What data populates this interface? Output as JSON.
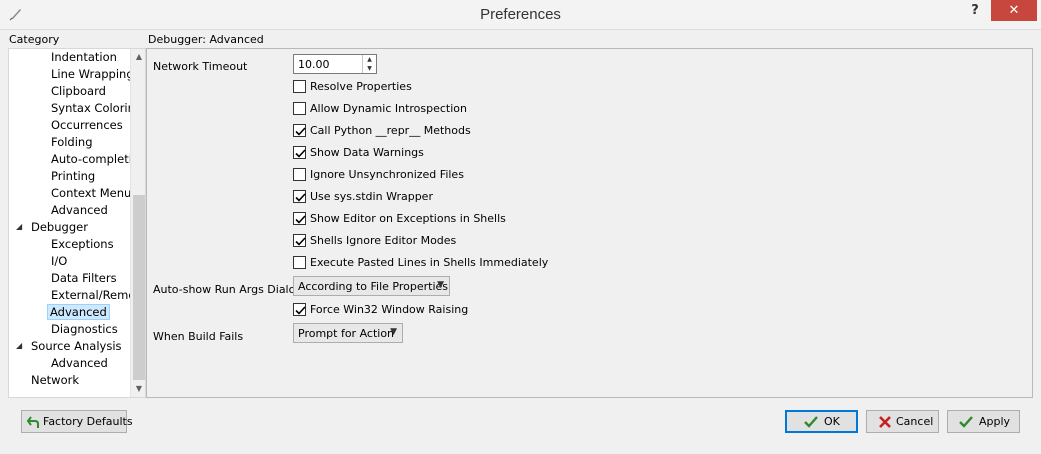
{
  "window": {
    "title": "Preferences",
    "help_label": "?",
    "close_label": "✕"
  },
  "category": {
    "label": "Category",
    "items": [
      {
        "label": "Indentation",
        "level": 2
      },
      {
        "label": "Line Wrapping",
        "level": 2
      },
      {
        "label": "Clipboard",
        "level": 2
      },
      {
        "label": "Syntax Coloring",
        "level": 2
      },
      {
        "label": "Occurrences",
        "level": 2
      },
      {
        "label": "Folding",
        "level": 2
      },
      {
        "label": "Auto-completi",
        "level": 2
      },
      {
        "label": "Printing",
        "level": 2
      },
      {
        "label": "Context Menu",
        "level": 2
      },
      {
        "label": "Advanced",
        "level": 2
      },
      {
        "label": "Debugger",
        "level": 1,
        "expanded": true
      },
      {
        "label": "Exceptions",
        "level": 2
      },
      {
        "label": "I/O",
        "level": 2
      },
      {
        "label": "Data Filters",
        "level": 2
      },
      {
        "label": "External/Remo",
        "level": 2
      },
      {
        "label": "Advanced",
        "level": 2,
        "selected": true
      },
      {
        "label": "Diagnostics",
        "level": 2
      },
      {
        "label": "Source Analysis",
        "level": 1,
        "expanded": true
      },
      {
        "label": "Advanced",
        "level": 2
      },
      {
        "label": "Network",
        "level": 1
      }
    ]
  },
  "section": {
    "title": "Debugger: Advanced"
  },
  "settings": {
    "network_timeout": {
      "label": "Network Timeout",
      "value": "10.00"
    },
    "checkboxes": [
      {
        "label": "Resolve Properties",
        "checked": false
      },
      {
        "label": "Allow Dynamic Introspection",
        "checked": false
      },
      {
        "label": "Call Python __repr__ Methods",
        "checked": true
      },
      {
        "label": "Show Data Warnings",
        "checked": true
      },
      {
        "label": "Ignore Unsynchronized Files",
        "checked": false
      },
      {
        "label": "Use sys.stdin Wrapper",
        "checked": true
      },
      {
        "label": "Show Editor on Exceptions in Shells",
        "checked": true
      },
      {
        "label": "Shells Ignore Editor Modes",
        "checked": true
      },
      {
        "label": "Execute Pasted Lines in Shells Immediately",
        "checked": false
      }
    ],
    "auto_show": {
      "label": "Auto-show Run Args Dialog",
      "value": "According to File Properties"
    },
    "force_raise": {
      "label": "Force Win32 Window Raising",
      "checked": true
    },
    "build_fails": {
      "label": "When Build Fails",
      "value": "Prompt for Action"
    }
  },
  "buttons": {
    "factory_defaults": "Factory Defaults",
    "ok": "OK",
    "cancel": "Cancel",
    "apply": "Apply"
  },
  "colors": {
    "accent": "#0078d7",
    "close": "#c7463d",
    "check_green": "#2d8a2d",
    "cancel_red": "#c8201e"
  }
}
